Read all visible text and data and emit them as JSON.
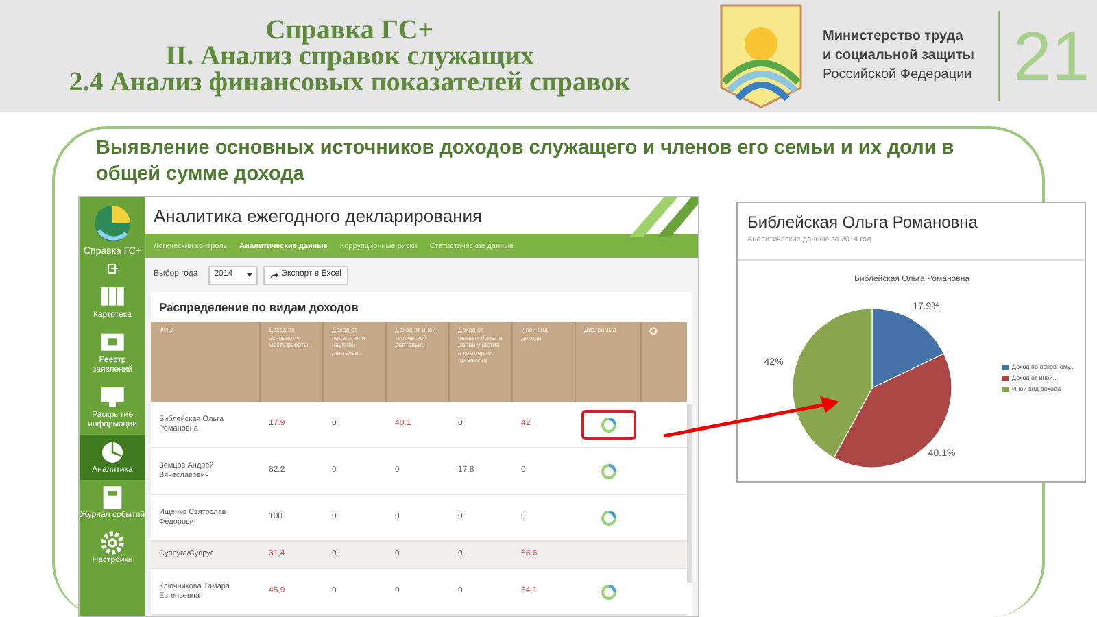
{
  "header": {
    "title_lines": [
      "Справка ГС+",
      "II. Анализ справок служащих",
      "2.4 Анализ финансовых показателей справок"
    ],
    "ministry_lines": [
      "Министерство труда",
      "и социальной защиты",
      "Российской Федерации"
    ],
    "page_number": "21"
  },
  "heading": "Выявление основных источников доходов служащего и членов его семьи и их доли в общей сумме дохода",
  "app": {
    "sidebar": {
      "brand": "Справка ГС+",
      "items": [
        {
          "label": "Картотека",
          "kind": "cabinet",
          "selected": false
        },
        {
          "label": "Реестр заявлений",
          "kind": "folder",
          "selected": false
        },
        {
          "label": "Раскрытие информации",
          "kind": "monitor",
          "selected": false
        },
        {
          "label": "Аналитика",
          "kind": "pie",
          "selected": true
        },
        {
          "label": "Журнал событий",
          "kind": "journal",
          "selected": false
        },
        {
          "label": "Настройки",
          "kind": "gear",
          "selected": false
        }
      ]
    },
    "title": "Аналитика ежегодного декларирования",
    "tabs": [
      {
        "label": "Логический контроль",
        "selected": false
      },
      {
        "label": "Аналитические данные",
        "selected": true
      },
      {
        "label": "Коррупционные риски",
        "selected": false
      },
      {
        "label": "Статистические данные",
        "selected": false
      }
    ],
    "year_label": "Выбор года",
    "year": "2014",
    "export_button": "Экспорт в Excel",
    "section_title": "Распределение по видам доходов",
    "table": {
      "columns": [
        "ФИО",
        "Доход по основному месту работы",
        "Доход от педагогич и научной деятельно",
        "Доход от иной творческой деятельно",
        "Доход от ценных бумаг и долей участия в коммерчес организац",
        "Иной вид дохода",
        "Диаграмма"
      ],
      "rows": [
        {
          "cells": [
            {
              "text": "Библейская Ольга Романовна",
              "alert": false
            },
            {
              "text": "17.9",
              "alert": true
            },
            {
              "text": "0",
              "alert": false
            },
            {
              "text": "40.1",
              "alert": true
            },
            {
              "text": "0",
              "alert": false
            },
            {
              "text": "42",
              "alert": true
            }
          ],
          "chart": true,
          "marked": true,
          "shaded": false
        },
        {
          "cells": [
            {
              "text": "Земцов Андрей Вячеславович",
              "alert": false
            },
            {
              "text": "82.2",
              "alert": false
            },
            {
              "text": "0",
              "alert": false
            },
            {
              "text": "0",
              "alert": false
            },
            {
              "text": "17.8",
              "alert": false
            },
            {
              "text": "0",
              "alert": false
            }
          ],
          "chart": true,
          "marked": false,
          "shaded": false
        },
        {
          "cells": [
            {
              "text": "Ищенко Святослав Федорович",
              "alert": false
            },
            {
              "text": "100",
              "alert": false
            },
            {
              "text": "0",
              "alert": false
            },
            {
              "text": "0",
              "alert": false
            },
            {
              "text": "0",
              "alert": false
            },
            {
              "text": "0",
              "alert": false
            }
          ],
          "chart": true,
          "marked": false,
          "shaded": false
        },
        {
          "cells": [
            {
              "text": "Супруга/Супруг",
              "alert": false
            },
            {
              "text": "31,4",
              "alert": true
            },
            {
              "text": "0",
              "alert": false
            },
            {
              "text": "0",
              "alert": false
            },
            {
              "text": "0",
              "alert": false
            },
            {
              "text": "68,6",
              "alert": true
            }
          ],
          "chart": false,
          "marked": false,
          "shaded": true
        },
        {
          "cells": [
            {
              "text": "Ключникова Тамара Евгеньевна",
              "alert": false
            },
            {
              "text": "45,9",
              "alert": true
            },
            {
              "text": "0",
              "alert": false
            },
            {
              "text": "0",
              "alert": false
            },
            {
              "text": "0",
              "alert": false
            },
            {
              "text": "54,1",
              "alert": true
            }
          ],
          "chart": true,
          "marked": false,
          "shaded": false
        }
      ]
    }
  },
  "chart_card": {
    "title": "Библейская Ольга Романовна",
    "subtitle": "Аналитические данные за 2014 год",
    "chart_data": {
      "type": "pie",
      "title": "Библейская Ольга Романовна",
      "categories": [
        "Доход по основному...",
        "Доход от иной...",
        "Иной вид дохода"
      ],
      "values": [
        17.9,
        40.1,
        42
      ],
      "value_labels": [
        "17.9%",
        "40.1%",
        "42%"
      ],
      "legend": "right"
    }
  }
}
